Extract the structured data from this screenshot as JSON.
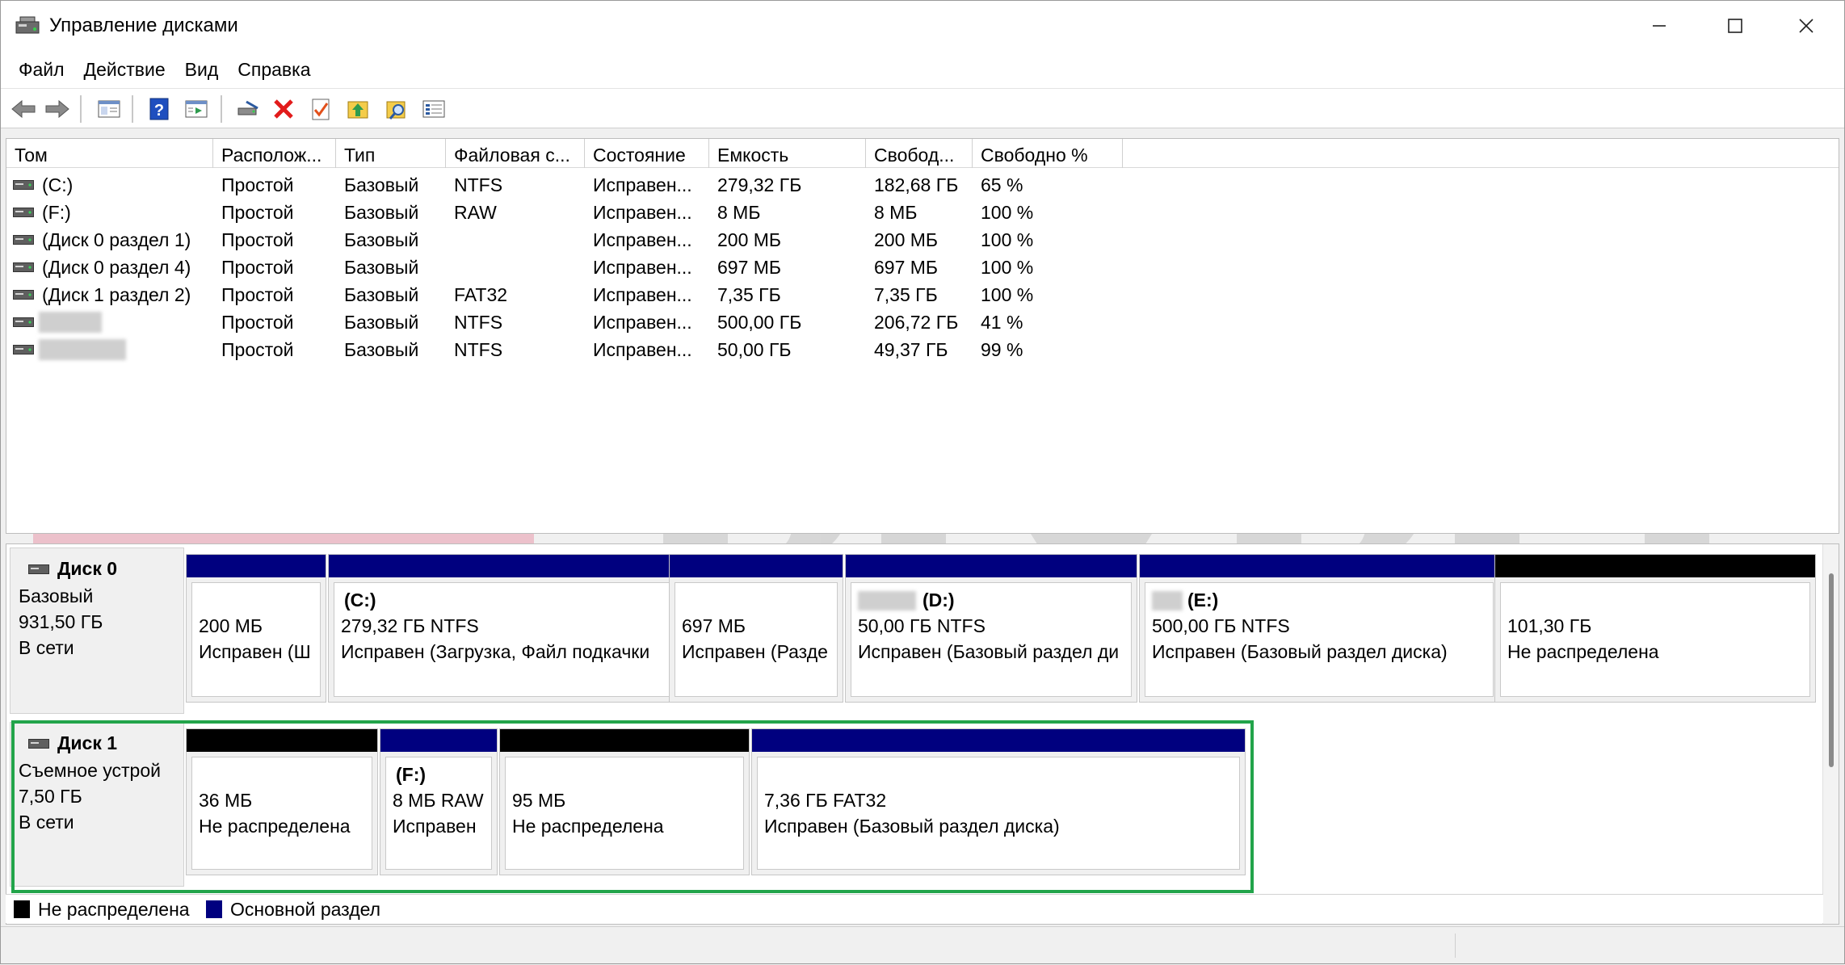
{
  "window": {
    "title": "Управление дисками"
  },
  "menu": [
    "Файл",
    "Действие",
    "Вид",
    "Справка"
  ],
  "toolbar": {
    "buttons": [
      "back-arrow-icon",
      "forward-arrow-icon",
      "console-tree-icon",
      "help-icon",
      "properties-pane-icon",
      "connect-drive-icon",
      "delete-icon",
      "check-icon",
      "folder-up-icon",
      "find-icon",
      "list-view-icon"
    ]
  },
  "volumes": {
    "columns": [
      "Том",
      "Располож...",
      "Тип",
      "Файловая с...",
      "Состояние",
      "Емкость",
      "Свобод...",
      "Свободно %"
    ],
    "rows": [
      {
        "name": "(C:)",
        "layout": "Простой",
        "type": "Базовый",
        "fs": "NTFS",
        "status": "Исправен...",
        "capacity": "279,32 ГБ",
        "free": "182,68 ГБ",
        "free_pct": "65 %"
      },
      {
        "name": "(F:)",
        "layout": "Простой",
        "type": "Базовый",
        "fs": "RAW",
        "status": "Исправен...",
        "capacity": "8 МБ",
        "free": "8 МБ",
        "free_pct": "100 %"
      },
      {
        "name": "(Диск 0 раздел 1)",
        "layout": "Простой",
        "type": "Базовый",
        "fs": "",
        "status": "Исправен...",
        "capacity": "200 МБ",
        "free": "200 МБ",
        "free_pct": "100 %"
      },
      {
        "name": "(Диск 0 раздел 4)",
        "layout": "Простой",
        "type": "Базовый",
        "fs": "",
        "status": "Исправен...",
        "capacity": "697 МБ",
        "free": "697 МБ",
        "free_pct": "100 %"
      },
      {
        "name": "(Диск 1 раздел 2)",
        "layout": "Простой",
        "type": "Базовый",
        "fs": "FAT32",
        "status": "Исправен...",
        "capacity": "7,35 ГБ",
        "free": "7,35 ГБ",
        "free_pct": "100 %"
      },
      {
        "name": "",
        "layout": "Простой",
        "type": "Базовый",
        "fs": "NTFS",
        "status": "Исправен...",
        "capacity": "500,00 ГБ",
        "free": "206,72 ГБ",
        "free_pct": "41 %"
      },
      {
        "name": "",
        "layout": "Простой",
        "type": "Базовый",
        "fs": "NTFS",
        "status": "Исправен...",
        "capacity": "50,00 ГБ",
        "free": "49,37 ГБ",
        "free_pct": "99 %"
      }
    ]
  },
  "disks": [
    {
      "title": "Диск 0",
      "kind": "Базовый",
      "size": "931,50 ГБ",
      "state": "В сети",
      "partitions": [
        {
          "label": "",
          "line1": "200 МБ",
          "line2": "Исправен (Ш",
          "bar": "primary"
        },
        {
          "label": "(C:)",
          "line1": "279,32 ГБ NTFS",
          "line2": "Исправен (Загрузка, Файл подкачки",
          "bar": "primary"
        },
        {
          "label": "",
          "line1": "697 МБ",
          "line2": "Исправен (Разде",
          "bar": "primary"
        },
        {
          "label": "(D:)",
          "line1": "50,00 ГБ NTFS",
          "line2": "Исправен (Базовый раздел ди",
          "bar": "primary"
        },
        {
          "label": "(E:)",
          "line1": "500,00 ГБ NTFS",
          "line2": "Исправен (Базовый раздел диска)",
          "bar": "primary"
        },
        {
          "label": "",
          "line1": "101,30 ГБ",
          "line2": "Не распределена",
          "bar": "unallocated"
        }
      ]
    },
    {
      "title": "Диск 1",
      "kind": "Съемное устрой",
      "size": "7,50 ГБ",
      "state": "В сети",
      "partitions": [
        {
          "label": "",
          "line1": "36 МБ",
          "line2": "Не распределена",
          "bar": "unallocated"
        },
        {
          "label": "(F:)",
          "line1": "8 МБ RAW",
          "line2": "Исправен",
          "bar": "primary"
        },
        {
          "label": "",
          "line1": "95 МБ",
          "line2": "Не распределена",
          "bar": "unallocated"
        },
        {
          "label": "",
          "line1": "7,36 ГБ FAT32",
          "line2": "Исправен (Базовый раздел диска)",
          "bar": "primary"
        }
      ]
    }
  ],
  "legend": {
    "unallocated": "Не распределена",
    "primary": "Основной раздел"
  },
  "colors": {
    "primary": "#00007f",
    "unallocated": "#000000",
    "highlight": "#22a44a",
    "watermark": "#c9c9c9"
  }
}
